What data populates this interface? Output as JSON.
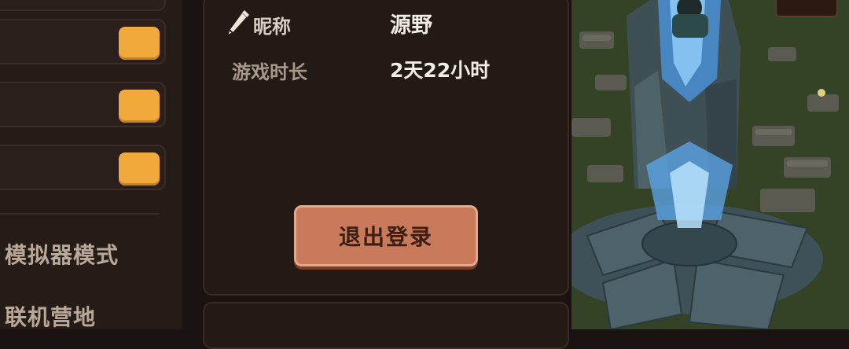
{
  "profile": {
    "nickname_label": "昵称",
    "nickname_value": "源野",
    "playtime_label": "游戏时长",
    "playtime_value": "2天22小时",
    "logout_label": "退出登录"
  },
  "settings": {
    "items": [
      {
        "on": true
      },
      {
        "on": true
      },
      {
        "on": true
      }
    ],
    "toggle_color": "#f0a93a"
  },
  "menu": {
    "emulator_mode": "模拟器模式",
    "coop_camp": "联机营地"
  },
  "icons": {
    "pencil": "pencil-icon"
  },
  "colors": {
    "panel_bg": "#231915",
    "button_bg": "#c97a5a",
    "text_primary": "#f3ece4",
    "text_secondary": "#a8988b"
  }
}
